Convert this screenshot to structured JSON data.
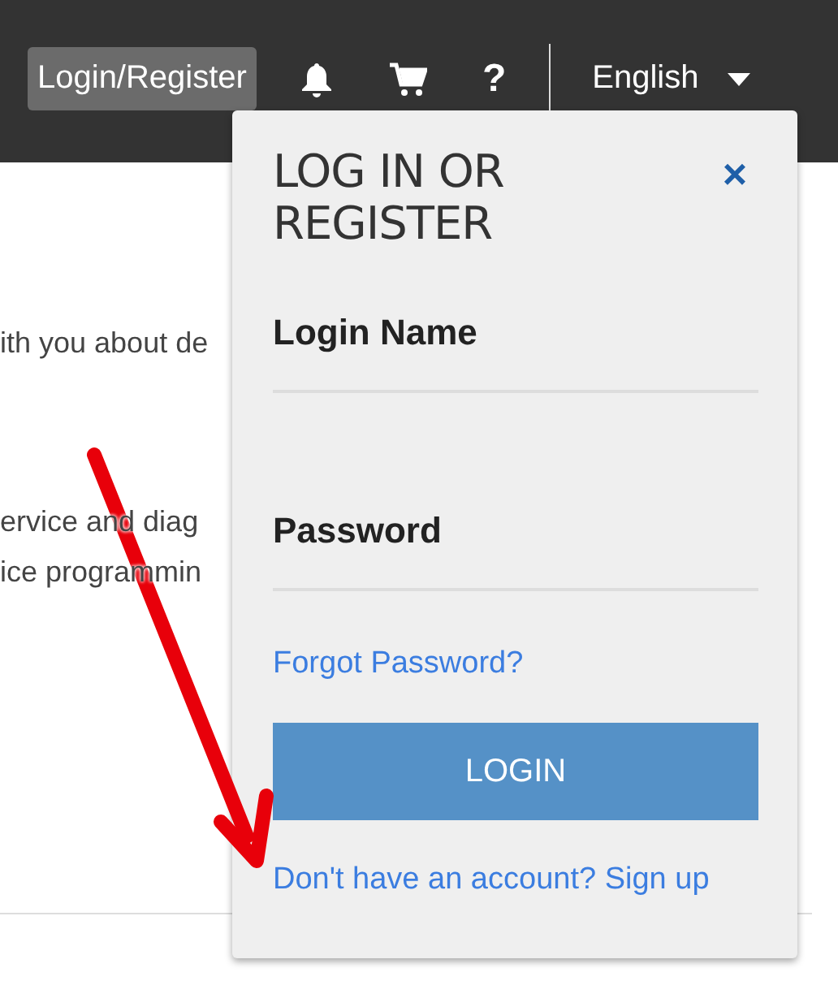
{
  "header": {
    "login_button": "Login/Register",
    "help": "?",
    "language": "English"
  },
  "page_text": [
    "ith you about de",
    "ervice and diag",
    "ice programmin"
  ],
  "login_popup": {
    "title": "LOG IN OR REGISTER",
    "close": "×",
    "fields": [
      {
        "label": "Login Name"
      },
      {
        "label": "Password"
      }
    ],
    "forgot_link": "Forgot Password?",
    "submit": "LOGIN",
    "signup_link": "Don't have an account? Sign up"
  }
}
